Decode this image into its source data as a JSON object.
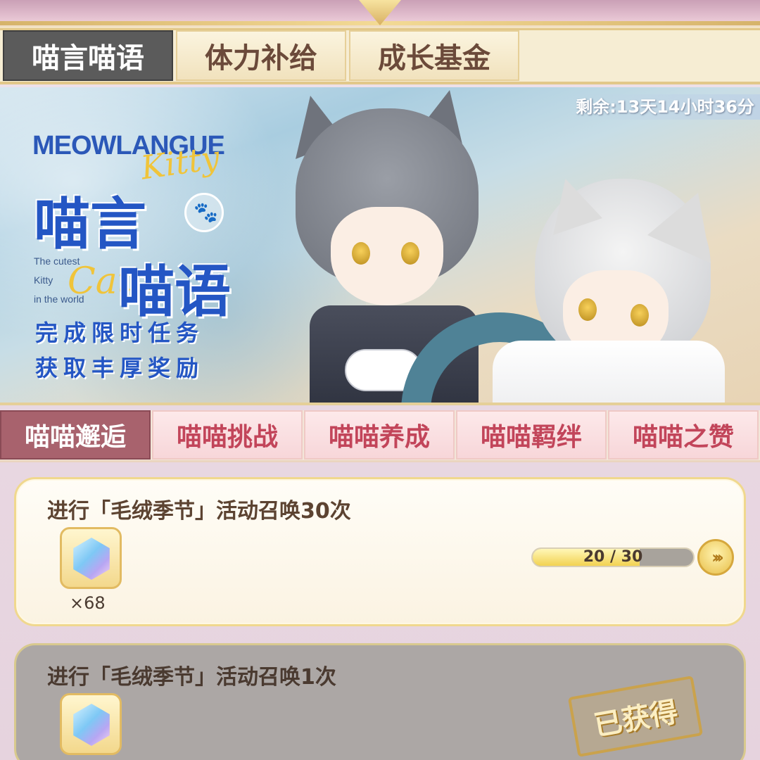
{
  "top_tabs": [
    "喵言喵语",
    "体力补给",
    "成长基金"
  ],
  "banner": {
    "en_title": "MEOWLANGUE",
    "kitty": "Kitty",
    "title_line1": "喵言",
    "title_line2": "喵语",
    "small_text": [
      "The cutest",
      "Kitty",
      "in the world"
    ],
    "cat": "Cat",
    "slogan_line1": "完成限时任务",
    "slogan_line2": "获取丰厚奖励",
    "timer": "剩余:13天14小时36分"
  },
  "sub_tabs": [
    "喵喵邂逅",
    "喵喵挑战",
    "喵喵养成",
    "喵喵羁绊",
    "喵喵之赞"
  ],
  "quests": [
    {
      "title": "进行「毛绒季节」活动召唤30次",
      "reward_icon": "crystal-icon",
      "reward_count": "×68",
      "progress_text": "20 / 30",
      "progress_value": 20,
      "progress_max": 30
    },
    {
      "title": "进行「毛绒季节」活动召唤1次",
      "reward_icon": "crystal-icon",
      "status": "已获得"
    }
  ],
  "colors": {
    "active_top_tab": "#5b5b5b",
    "active_sub_tab": "#a8626d",
    "sub_tab_text": "#c2455a",
    "banner_title": "#2456c4"
  }
}
